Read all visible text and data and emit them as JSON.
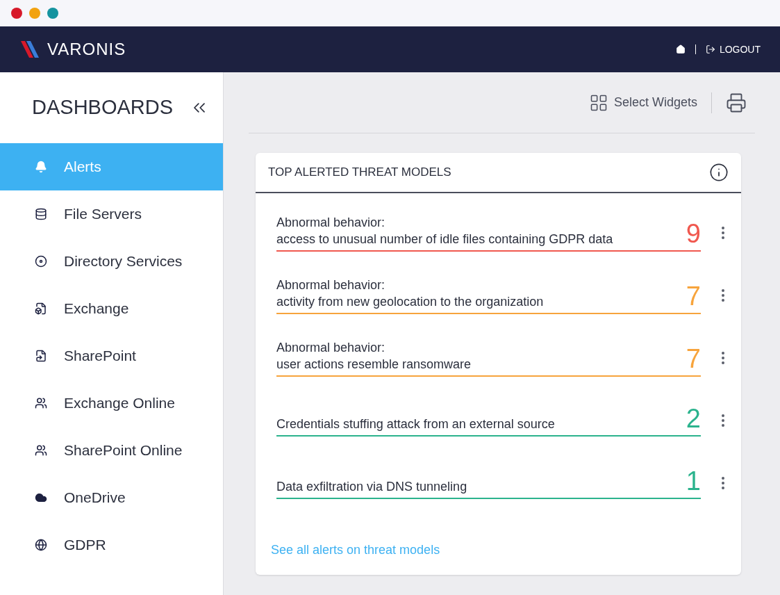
{
  "header": {
    "brand": "VARONIS",
    "logout": "LOGOUT"
  },
  "sidebar": {
    "title": "DASHBOARDS",
    "items": [
      {
        "label": "Alerts",
        "selected": true
      },
      {
        "label": "File Servers",
        "selected": false
      },
      {
        "label": "Directory Services",
        "selected": false
      },
      {
        "label": "Exchange",
        "selected": false
      },
      {
        "label": "SharePoint",
        "selected": false
      },
      {
        "label": "Exchange Online",
        "selected": false
      },
      {
        "label": "SharePoint Online",
        "selected": false
      },
      {
        "label": "OneDrive",
        "selected": false
      },
      {
        "label": "GDPR",
        "selected": false
      }
    ]
  },
  "toolbar": {
    "select_widgets": "Select Widgets"
  },
  "widget": {
    "title": "TOP ALERTED THREAT MODELS",
    "rows": [
      {
        "category": "Abnormal behavior:",
        "description": "access to unusual number of idle files containing GDPR data",
        "count": "9",
        "color": "#f0584f"
      },
      {
        "category": "Abnormal behavior:",
        "description": "activity from new geolocation to the organization",
        "count": "7",
        "color": "#f7a43c"
      },
      {
        "category": "Abnormal behavior:",
        "description": "user actions resemble ransomware",
        "count": "7",
        "color": "#f7a43c"
      },
      {
        "description": "Credentials stuffing attack from an external source",
        "count": "2",
        "color": "#2bb38d"
      },
      {
        "description": "Data exfiltration via DNS tunneling",
        "count": "1",
        "color": "#2bb38d"
      }
    ],
    "link": "See all alerts on threat models"
  }
}
